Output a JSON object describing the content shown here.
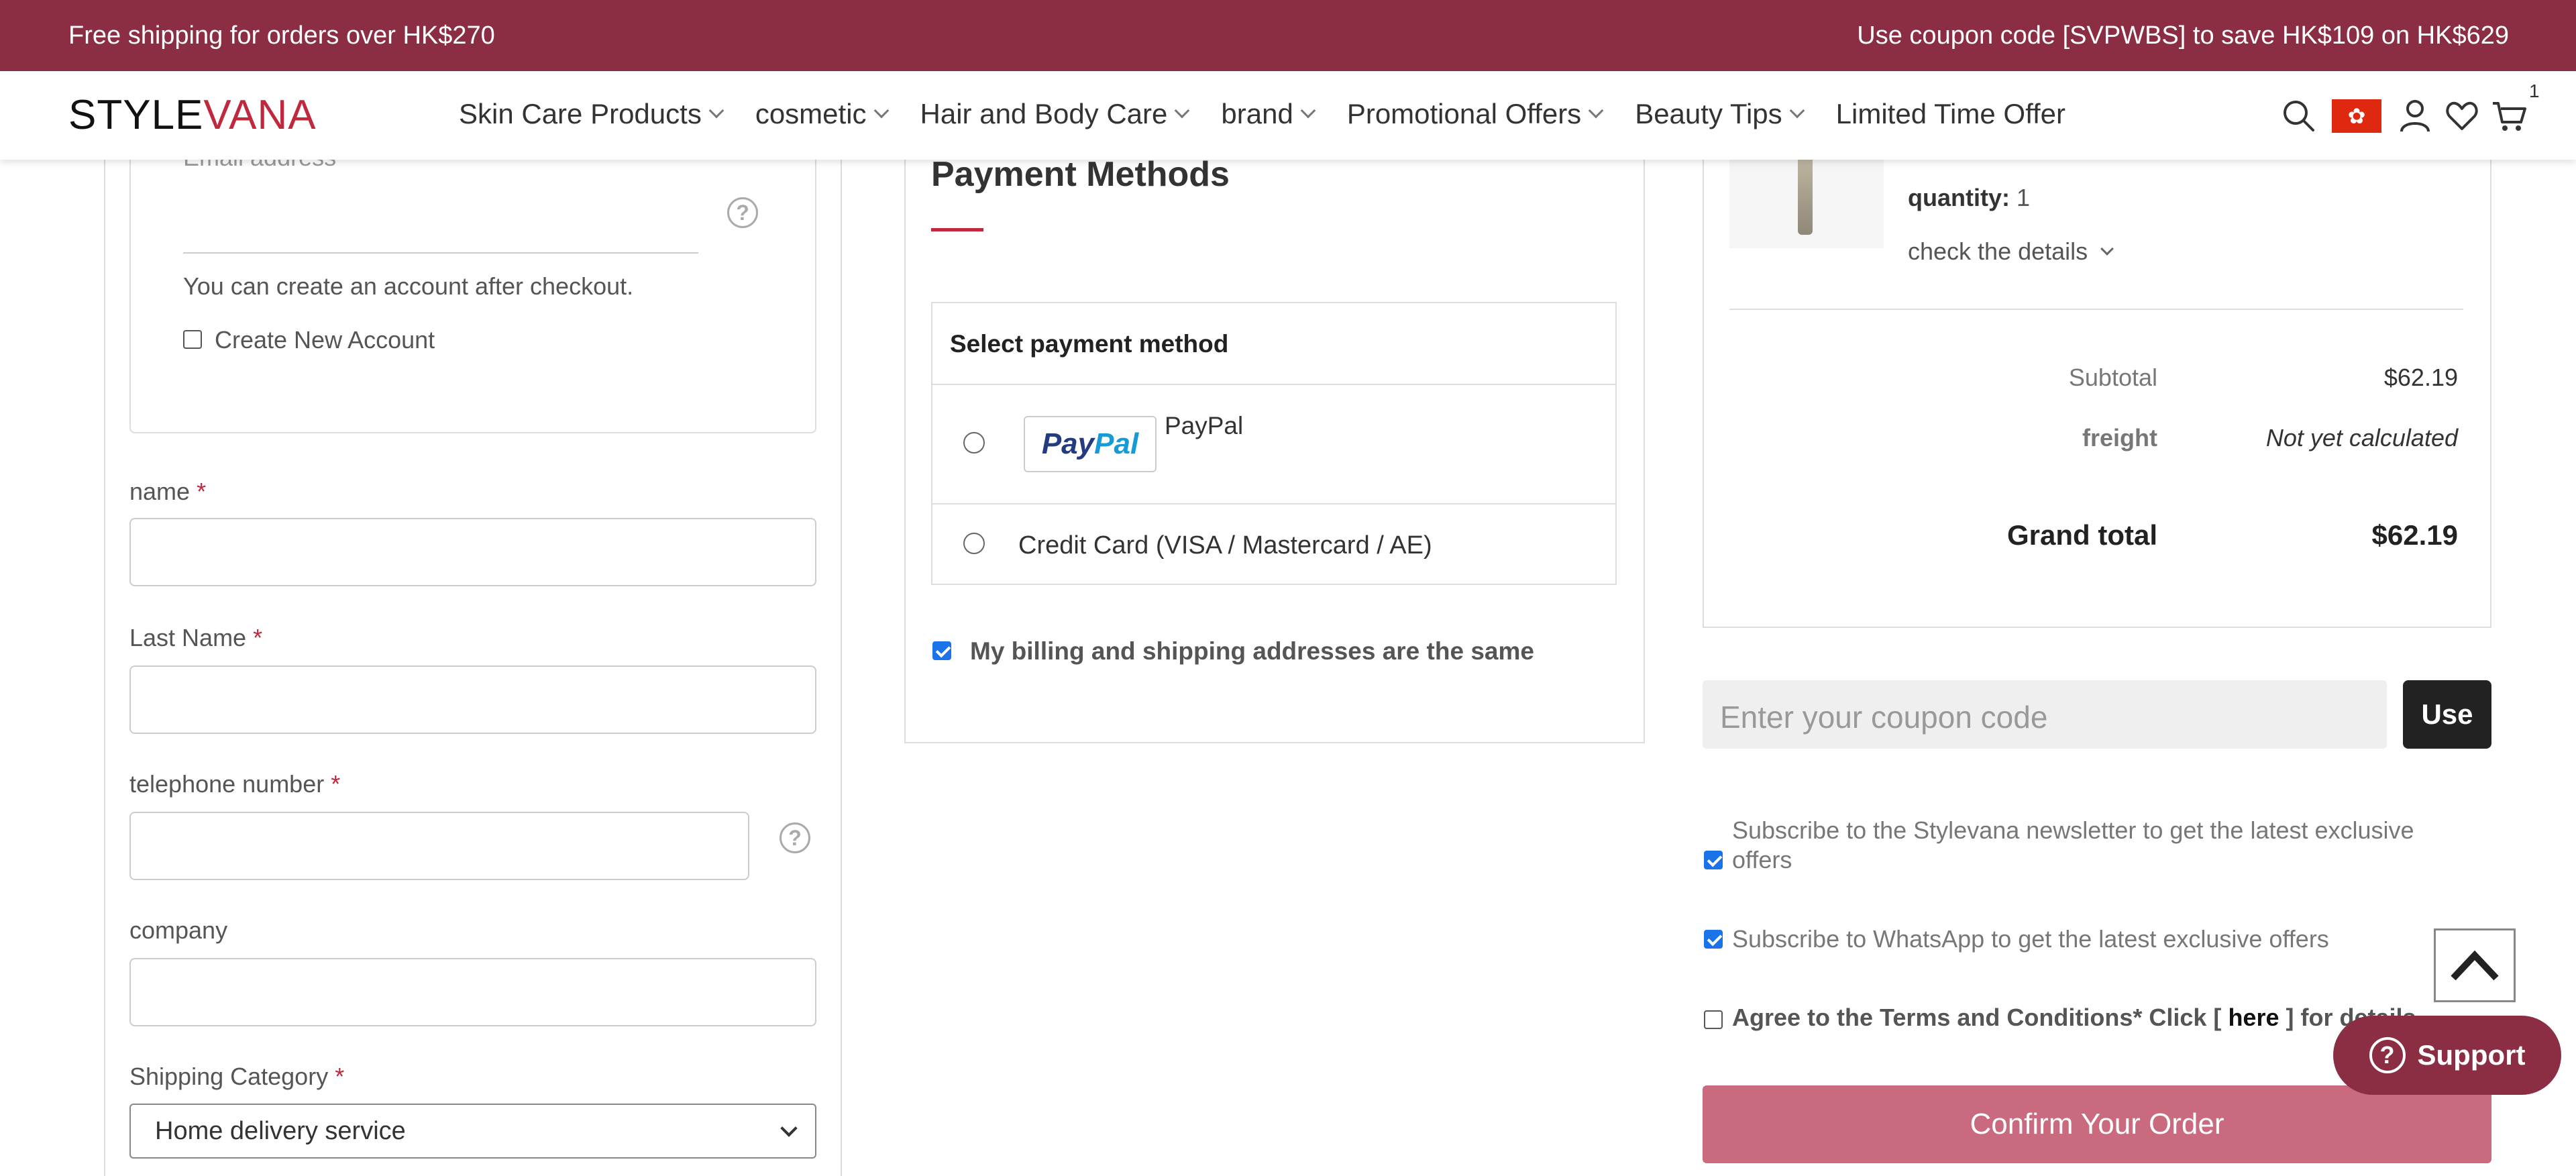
{
  "promo": {
    "left_text": "Free shipping for orders over HK$270",
    "right_text": "Use coupon code [SVPWBS] to save HK$109 on HK$629"
  },
  "header": {
    "logo_main": "STYLE",
    "logo_accent": "VANA",
    "nav": [
      {
        "label": "Skin Care Products",
        "has_dropdown": true
      },
      {
        "label": "cosmetic",
        "has_dropdown": true
      },
      {
        "label": "Hair and Body Care",
        "has_dropdown": true
      },
      {
        "label": "brand",
        "has_dropdown": true
      },
      {
        "label": "Promotional Offers",
        "has_dropdown": true
      },
      {
        "label": "Beauty Tips",
        "has_dropdown": true
      },
      {
        "label": "Limited Time Offer",
        "has_dropdown": false
      }
    ],
    "icons": [
      "search-icon",
      "hk-flag-icon",
      "user-icon",
      "heart-icon",
      "cart-icon"
    ],
    "cart_count": "1",
    "flag_color": "#de2910"
  },
  "left": {
    "email_label": "Email address *",
    "account_note": "You can create an account after checkout.",
    "create_account_label": "Create New Account",
    "fields": {
      "name": "name",
      "last_name": "Last Name",
      "telephone": "telephone number",
      "company": "company",
      "shipping_category": "Shipping Category"
    },
    "required_mark": "*",
    "shipping_selected": "Home delivery service"
  },
  "payment": {
    "title": "Payment Methods",
    "select_header": "Select payment method",
    "options": [
      {
        "label": "PayPal",
        "logo_text_1": "Pay",
        "logo_text_2": "Pal"
      },
      {
        "label": "Credit Card (VISA / Mastercard / AE)"
      }
    ],
    "billing_same_label": "My billing and shipping addresses are the same"
  },
  "summary": {
    "quantity_label": "quantity:",
    "quantity_value": "1",
    "details_link": "check the details",
    "subtotal_label": "Subtotal",
    "subtotal_value": "$62.19",
    "freight_label": "freight",
    "freight_value": "Not yet calculated",
    "grand_total_label": "Grand total",
    "grand_total_value": "$62.19",
    "coupon_placeholder": "Enter your coupon code",
    "use_button": "Use",
    "newsletter_label": "Subscribe to the Stylevana newsletter to get the latest exclusive offers",
    "whatsapp_label": "Subscribe to WhatsApp to get the latest exclusive offers",
    "terms_prefix": "Agree to the Terms and Conditions* Click [ ",
    "terms_link": "here",
    "terms_suffix": " ] for details",
    "confirm_button": "Confirm Your Order",
    "support_button": "Support"
  },
  "colors": {
    "brand": "#8b2e44",
    "accent": "#c0283e",
    "confirm": "#c96a7e"
  }
}
